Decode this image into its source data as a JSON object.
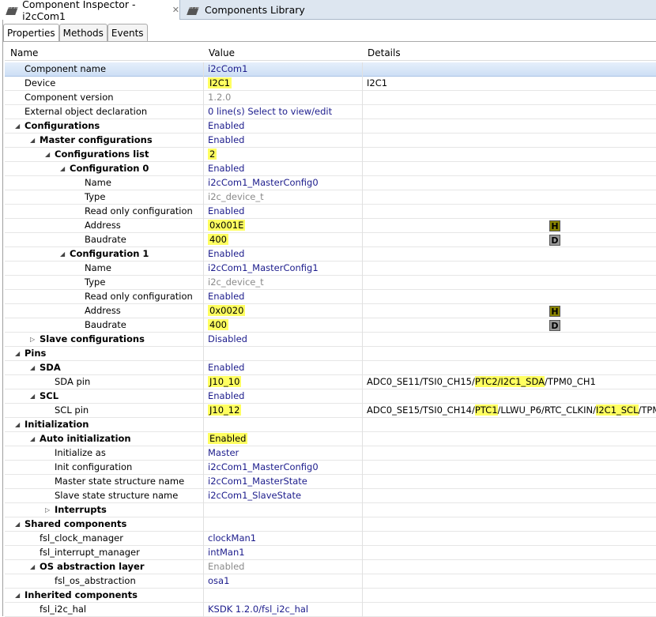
{
  "tabs": [
    {
      "label": "Component Inspector - i2cCom1",
      "active": true
    },
    {
      "label": "Components Library",
      "active": false
    }
  ],
  "subtabs": [
    "Properties",
    "Methods",
    "Events"
  ],
  "columns": [
    "Name",
    "Value",
    "Details"
  ],
  "colors": {
    "value": "#1c1c8c",
    "highlight": "#ffff60",
    "readonly": "#8a8a8a"
  },
  "rows": [
    {
      "level": 0,
      "exp": "",
      "bold": false,
      "name": "Component name",
      "value": "i2cCom1",
      "style": "v",
      "selected": true
    },
    {
      "level": 0,
      "exp": "",
      "bold": false,
      "name": "Device",
      "value": "I2C1",
      "style": "hl",
      "details": [
        {
          "t": "I2C1"
        }
      ]
    },
    {
      "level": 0,
      "exp": "",
      "bold": false,
      "name": "Component version",
      "value": "1.2.0",
      "style": "g"
    },
    {
      "level": 0,
      "exp": "",
      "bold": false,
      "name": "External object declaration",
      "value": "0 line(s)    Select to view/edit",
      "style": "v"
    },
    {
      "level": 0,
      "exp": "open",
      "bold": true,
      "name": "Configurations",
      "value": "Enabled",
      "style": "v"
    },
    {
      "level": 1,
      "exp": "open",
      "bold": true,
      "name": "Master configurations",
      "value": "Enabled",
      "style": "v"
    },
    {
      "level": 2,
      "exp": "open",
      "bold": true,
      "name": "Configurations list",
      "value": "2",
      "style": "hl"
    },
    {
      "level": 3,
      "exp": "open",
      "bold": true,
      "name": "Configuration 0",
      "value": "Enabled",
      "style": "v"
    },
    {
      "level": 4,
      "exp": "",
      "bold": false,
      "name": "Name",
      "value": "i2cCom1_MasterConfig0",
      "style": "v"
    },
    {
      "level": 4,
      "exp": "",
      "bold": false,
      "name": "Type",
      "value": "i2c_device_t",
      "style": "g"
    },
    {
      "level": 4,
      "exp": "",
      "bold": false,
      "name": "Read only configuration",
      "value": "Enabled",
      "style": "v"
    },
    {
      "level": 4,
      "exp": "",
      "bold": false,
      "name": "Address",
      "value": "0x001E",
      "style": "hl",
      "btn": "H"
    },
    {
      "level": 4,
      "exp": "",
      "bold": false,
      "name": "Baudrate",
      "value": "400",
      "style": "hl",
      "btn": "D"
    },
    {
      "level": 3,
      "exp": "open",
      "bold": true,
      "name": "Configuration 1",
      "value": "Enabled",
      "style": "v"
    },
    {
      "level": 4,
      "exp": "",
      "bold": false,
      "name": "Name",
      "value": "i2cCom1_MasterConfig1",
      "style": "v"
    },
    {
      "level": 4,
      "exp": "",
      "bold": false,
      "name": "Type",
      "value": "i2c_device_t",
      "style": "g"
    },
    {
      "level": 4,
      "exp": "",
      "bold": false,
      "name": "Read only configuration",
      "value": "Enabled",
      "style": "v"
    },
    {
      "level": 4,
      "exp": "",
      "bold": false,
      "name": "Address",
      "value": "0x0020",
      "style": "hl",
      "btn": "H"
    },
    {
      "level": 4,
      "exp": "",
      "bold": false,
      "name": "Baudrate",
      "value": "400",
      "style": "hl",
      "btn": "D"
    },
    {
      "level": 1,
      "exp": "closed",
      "bold": true,
      "name": "Slave configurations",
      "value": "Disabled",
      "style": "v"
    },
    {
      "level": 0,
      "exp": "open",
      "bold": true,
      "name": "Pins",
      "value": "",
      "style": "v"
    },
    {
      "level": 1,
      "exp": "open",
      "bold": true,
      "name": "SDA",
      "value": "Enabled",
      "style": "v"
    },
    {
      "level": 2,
      "exp": "",
      "bold": false,
      "name": "SDA pin",
      "value": "J10_10",
      "style": "hl",
      "details": [
        {
          "t": "ADC0_SE11/TSI0_CH15/"
        },
        {
          "t": "PTC2/I2C1_SDA",
          "h": true
        },
        {
          "t": "/TPM0_CH1"
        }
      ]
    },
    {
      "level": 1,
      "exp": "open",
      "bold": true,
      "name": "SCL",
      "value": "Enabled",
      "style": "v"
    },
    {
      "level": 2,
      "exp": "",
      "bold": false,
      "name": "SCL pin",
      "value": "J10_12",
      "style": "hl",
      "details": [
        {
          "t": "ADC0_SE15/TSI0_CH14/"
        },
        {
          "t": "PTC1",
          "h": true
        },
        {
          "t": "/LLWU_P6/RTC_CLKIN/"
        },
        {
          "t": "I2C1_SCL",
          "h": true
        },
        {
          "t": "/TPM..."
        }
      ]
    },
    {
      "level": 0,
      "exp": "open",
      "bold": true,
      "name": "Initialization",
      "value": "",
      "style": "v"
    },
    {
      "level": 1,
      "exp": "open",
      "bold": true,
      "name": "Auto initialization",
      "value": "Enabled",
      "style": "hl"
    },
    {
      "level": 2,
      "exp": "",
      "bold": false,
      "name": "Initialize as",
      "value": "Master",
      "style": "v"
    },
    {
      "level": 2,
      "exp": "",
      "bold": false,
      "name": "Init configuration",
      "value": "i2cCom1_MasterConfig0",
      "style": "v"
    },
    {
      "level": 2,
      "exp": "",
      "bold": false,
      "name": "Master state structure name",
      "value": "i2cCom1_MasterState",
      "style": "v"
    },
    {
      "level": 2,
      "exp": "",
      "bold": false,
      "name": "Slave state structure name",
      "value": "i2cCom1_SlaveState",
      "style": "v"
    },
    {
      "level": 2,
      "exp": "closed",
      "bold": true,
      "name": "Interrupts",
      "value": "",
      "style": "v"
    },
    {
      "level": 0,
      "exp": "open",
      "bold": true,
      "name": "Shared components",
      "value": "",
      "style": "v"
    },
    {
      "level": 1,
      "exp": "",
      "bold": false,
      "name": "fsl_clock_manager",
      "value": "clockMan1",
      "style": "v"
    },
    {
      "level": 1,
      "exp": "",
      "bold": false,
      "name": "fsl_interrupt_manager",
      "value": "intMan1",
      "style": "v"
    },
    {
      "level": 1,
      "exp": "open",
      "bold": true,
      "name": "OS abstraction layer",
      "value": "Enabled",
      "style": "g"
    },
    {
      "level": 2,
      "exp": "",
      "bold": false,
      "name": "fsl_os_abstraction",
      "value": "osa1",
      "style": "v"
    },
    {
      "level": 0,
      "exp": "open",
      "bold": true,
      "name": "Inherited components",
      "value": "",
      "style": "v"
    },
    {
      "level": 1,
      "exp": "",
      "bold": false,
      "name": "fsl_i2c_hal",
      "value": "KSDK 1.2.0/fsl_i2c_hal",
      "style": "v"
    }
  ]
}
